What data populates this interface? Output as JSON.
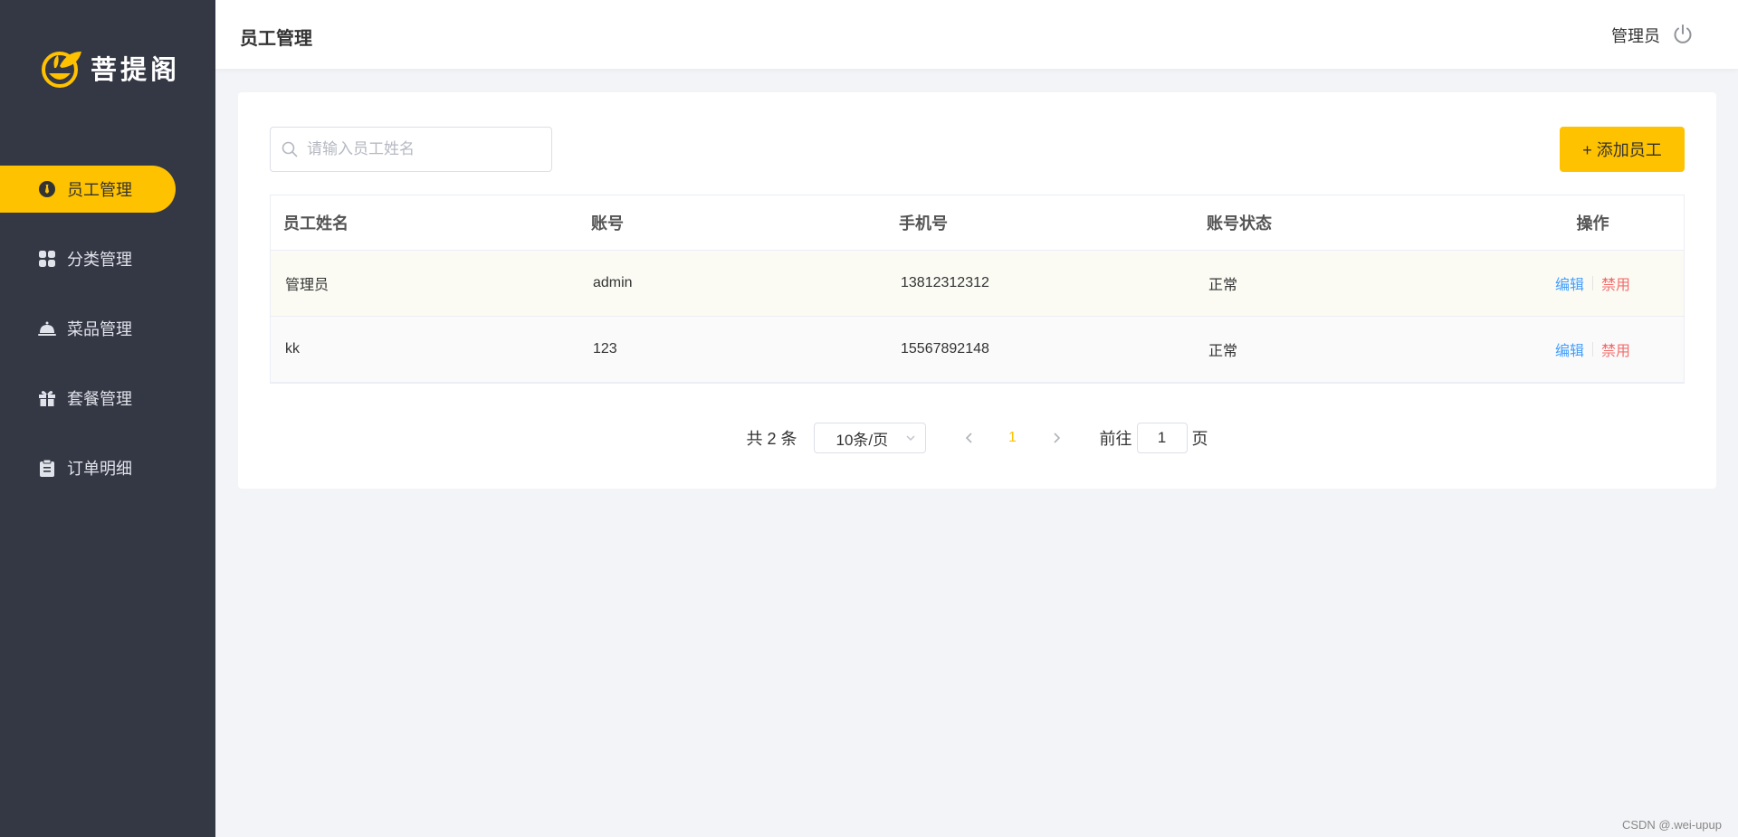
{
  "brand": {
    "name": "菩提阁",
    "accent": "#ffc200",
    "sidebar_bg": "#343744"
  },
  "sidebar": {
    "items": [
      {
        "label": "员工管理",
        "icon": "employee-icon",
        "active": true
      },
      {
        "label": "分类管理",
        "icon": "category-grid-icon",
        "active": false
      },
      {
        "label": "菜品管理",
        "icon": "dish-cloche-icon",
        "active": false
      },
      {
        "label": "套餐管理",
        "icon": "gift-icon",
        "active": false
      },
      {
        "label": "订单明细",
        "icon": "clipboard-icon",
        "active": false
      }
    ]
  },
  "header": {
    "title": "员工管理",
    "user": "管理员",
    "logout_icon": "power-icon"
  },
  "toolbar": {
    "search_placeholder": "请输入员工姓名",
    "search_value": "",
    "add_label": "+ 添加员工"
  },
  "table": {
    "columns": [
      "员工姓名",
      "账号",
      "手机号",
      "账号状态",
      "操作"
    ],
    "rows": [
      {
        "name": "管理员",
        "account": "admin",
        "phone": "13812312312",
        "status": "正常",
        "edit": "编辑",
        "disable": "禁用"
      },
      {
        "name": "kk",
        "account": "123",
        "phone": "15567892148",
        "status": "正常",
        "edit": "编辑",
        "disable": "禁用"
      }
    ]
  },
  "pagination": {
    "total_text": "共 2 条",
    "page_size": "10条/页",
    "current_page": "1",
    "goto_prefix": "前往",
    "goto_value": "1",
    "goto_suffix": "页"
  },
  "watermark": "CSDN @.wei-upup"
}
